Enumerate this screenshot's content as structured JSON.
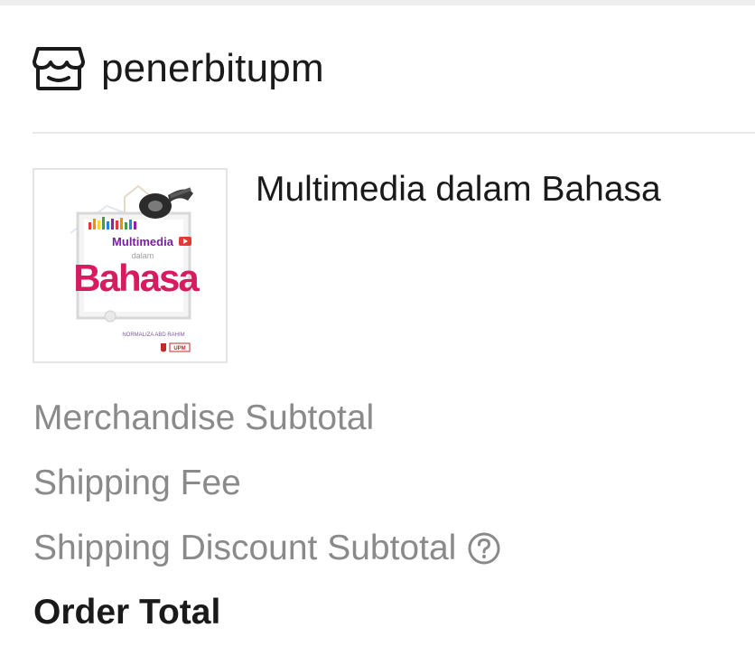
{
  "shop": {
    "icon": "shop-icon",
    "name": "penerbitupm"
  },
  "product": {
    "title": "Multimedia dalam Bahasa",
    "cover": {
      "title_line1": "Multimedia",
      "title_line2": "dalam",
      "title_line3": "Bahasa",
      "author": "NORMALIZA ABD RAHIM",
      "publisher_mark": "UPM"
    }
  },
  "summary": {
    "merchandise_subtotal_label": "Merchandise Subtotal",
    "shipping_fee_label": "Shipping Fee",
    "shipping_discount_label": "Shipping Discount Subtotal",
    "help_icon": "question-circle-icon",
    "order_total_label": "Order Total"
  }
}
